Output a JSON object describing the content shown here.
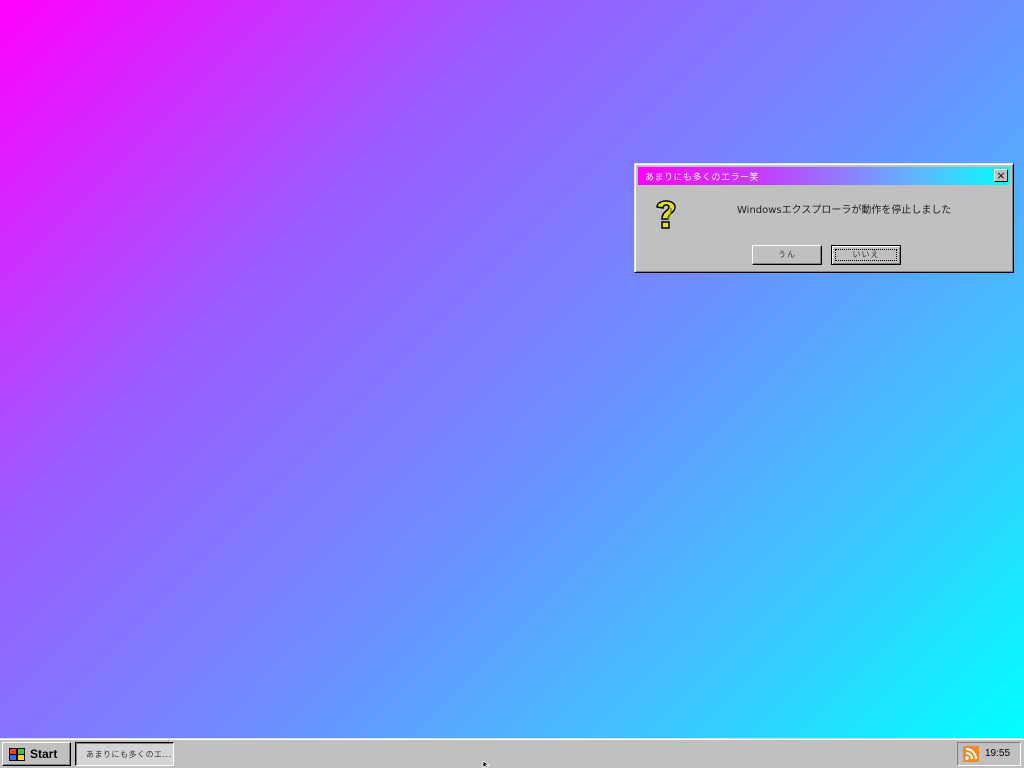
{
  "dialog": {
    "title": "あまりにも多くのエラー笑",
    "close_label": "×",
    "icon": "question-mark-icon",
    "message": "Windowsエクスプローラが動作を停止しました",
    "yes_label": "うん",
    "no_label": "いいえ"
  },
  "taskbar": {
    "start_label": "Start",
    "start_icon": "windows-flag-icon",
    "task_label": "あまりにも多くのエ...",
    "tray_icon": "rss-feed-icon",
    "clock": "19:55"
  },
  "colors": {
    "desktop_gradient_start": "#ff00ff",
    "desktop_gradient_end": "#00ffff",
    "window_face": "#c0c0c0",
    "rss_orange": "#f08a24",
    "question_yellow": "#e6e600"
  }
}
